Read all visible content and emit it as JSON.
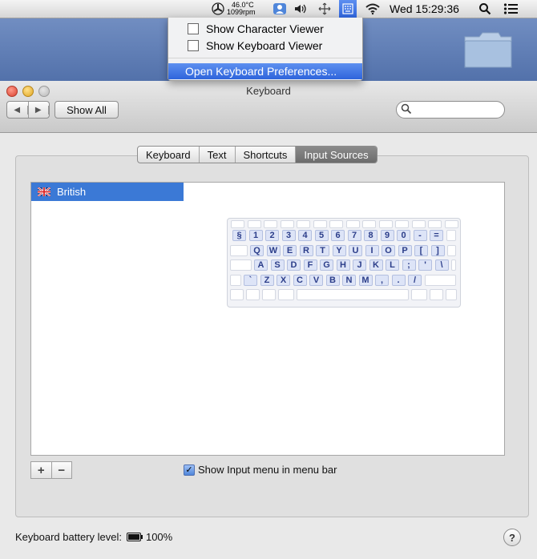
{
  "menubar": {
    "temperature": "46.0°C",
    "fan_speed": "1099rpm",
    "clock": "Wed 15:29:36"
  },
  "menu": {
    "items": [
      {
        "label": "Show Character Viewer"
      },
      {
        "label": "Show Keyboard Viewer"
      },
      {
        "label": "Open Keyboard Preferences..."
      }
    ]
  },
  "window": {
    "title": "Keyboard",
    "show_all": "Show All",
    "search_placeholder": ""
  },
  "tabs": [
    {
      "label": "Keyboard"
    },
    {
      "label": "Text"
    },
    {
      "label": "Shortcuts"
    },
    {
      "label": "Input Sources",
      "active": true
    }
  ],
  "sources": [
    {
      "label": "British",
      "selected": true
    }
  ],
  "keyboard_rows": [
    [
      "§",
      "1",
      "2",
      "3",
      "4",
      "5",
      "6",
      "7",
      "8",
      "9",
      "0",
      "-",
      "="
    ],
    [
      "Q",
      "W",
      "E",
      "R",
      "T",
      "Y",
      "U",
      "I",
      "O",
      "P",
      "[",
      "]"
    ],
    [
      "A",
      "S",
      "D",
      "F",
      "G",
      "H",
      "J",
      "K",
      "L",
      ";",
      "'",
      "\\"
    ],
    [
      "`",
      "Z",
      "X",
      "C",
      "V",
      "B",
      "N",
      "M",
      ",",
      ".",
      "/"
    ]
  ],
  "checkbox": {
    "label": "Show Input menu in menu bar",
    "checked": true
  },
  "battery": {
    "label": "Keyboard battery level:",
    "value": "100%"
  },
  "help": "?",
  "add": "+",
  "remove": "−",
  "colors": {
    "selection": "#3b79d6",
    "menu_highlight": "#2f65dc"
  }
}
